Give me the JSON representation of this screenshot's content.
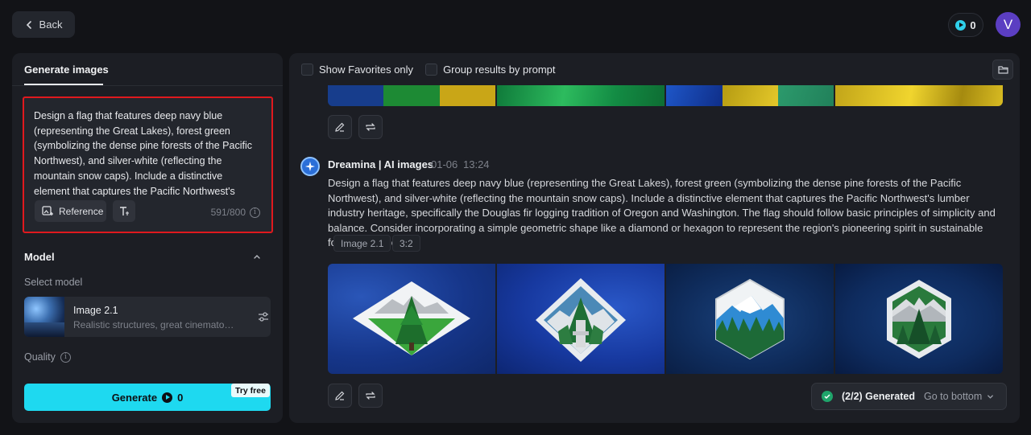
{
  "topbar": {
    "back_label": "Back",
    "credits": "0",
    "avatar_initial": "V"
  },
  "left_panel": {
    "tab_label": "Generate images",
    "prompt_text": "Design a flag that features deep navy blue (representing the Great Lakes), forest green (symbolizing the dense pine forests of the Pacific Northwest), and silver-white (reflecting the mountain snow caps). Include a distinctive element that captures the Pacific Northwest's lumber industry heritage, specifically the Douglas fir logging tradition of Oregon and Washington. The flag should follow basic principles of simplicity and balance. Consider incorporating a simple geometric shape like a diamond or hexagon to represent the region's pioneering spirit in sustainable forestry practices.",
    "reference_label": "Reference",
    "char_count": "591/800",
    "model_section_label": "Model",
    "select_model_label": "Select model",
    "model": {
      "name": "Image 2.1",
      "description": "Realistic structures, great cinematography"
    },
    "quality_label": "Quality",
    "generate_label": "Generate",
    "generate_cost": "0",
    "try_free_label": "Try free"
  },
  "right_panel": {
    "show_favorites_label": "Show Favorites only",
    "group_results_label": "Group results by prompt",
    "entry": {
      "author": "Dreamina | AI images",
      "date": "01-06",
      "time": "13:24",
      "prompt": "Design a flag that features deep navy blue (representing the Great Lakes), forest green (symbolizing the dense pine forests of the Pacific Northwest), and silver-white (reflecting the mountain snow caps). Include a distinctive element that captures the Pacific Northwest's lumber industry heritage, specifically the Douglas fir logging tradition of Oregon and Washington. The flag should follow basic principles of simplicity and balance. Consider incorporating a simple geometric shape like a diamond or hexagon to represent the region's pioneering spirit in sustainable forestry practices.",
      "tags": [
        "Image 2.1",
        "3:2"
      ]
    },
    "status_text": "(2/2) Generated",
    "goto_label": "Go to bottom"
  },
  "colors": {
    "accent": "#1ed9f0",
    "highlight_border": "#e0191e",
    "avatar": "#5b3ec2",
    "success": "#1fa56b"
  },
  "icons": {
    "back": "chevron-left-icon",
    "credits": "play-circle-icon",
    "reference": "add-image-icon",
    "text_tool": "text-icon",
    "info": "info-icon",
    "collapse": "chevron-up-icon",
    "settings": "sliders-icon",
    "folder": "folder-icon",
    "edit": "pencil-icon",
    "regenerate": "repeat-icon",
    "ai_logo": "sparkle-icon",
    "status": "check-circle-icon",
    "goto": "chevron-down-icon"
  }
}
